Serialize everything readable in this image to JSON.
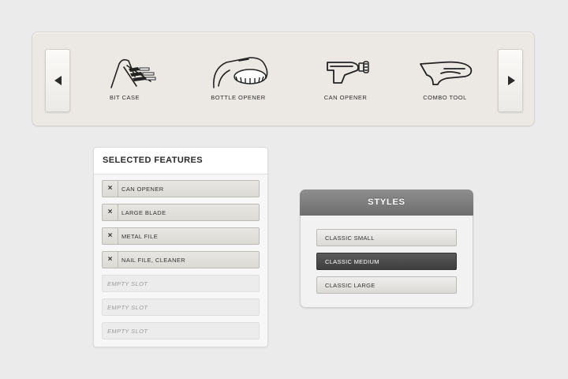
{
  "carousel": {
    "prev_icon": "triangle-left",
    "next_icon": "triangle-right",
    "tools": [
      {
        "label": "BIT CASE",
        "icon": "bit-case-icon"
      },
      {
        "label": "BOTTLE OPENER",
        "icon": "bottle-opener-icon"
      },
      {
        "label": "CAN OPENER",
        "icon": "can-opener-icon"
      },
      {
        "label": "COMBO TOOL",
        "icon": "combo-tool-icon"
      }
    ]
  },
  "selected_features": {
    "title": "SELECTED FEATURES",
    "remove_glyph": "×",
    "slots": [
      {
        "label": "CAN OPENER",
        "state": "filled"
      },
      {
        "label": "LARGE BLADE",
        "state": "filled"
      },
      {
        "label": "METAL FILE",
        "state": "filled"
      },
      {
        "label": "NAIL FILE, CLEANER",
        "state": "filled"
      },
      {
        "label": "EMPTY SLOT",
        "state": "empty"
      },
      {
        "label": "EMPTY SLOT",
        "state": "empty"
      },
      {
        "label": "EMPTY SLOT",
        "state": "empty"
      }
    ]
  },
  "styles": {
    "title": "STYLES",
    "options": [
      {
        "label": "CLASSIC SMALL",
        "selected": false
      },
      {
        "label": "CLASSIC MEDIUM",
        "selected": true
      },
      {
        "label": "CLASSIC LARGE",
        "selected": false
      }
    ]
  },
  "colors": {
    "background": "#ebebeb",
    "carousel_bg": "#ece9e4",
    "styles_header": "#7c7c7c",
    "active_option": "#4a4a4a"
  }
}
